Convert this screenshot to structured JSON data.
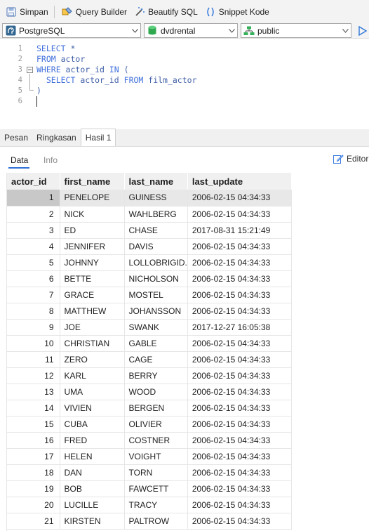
{
  "toolbar": {
    "save_label": "Simpan",
    "query_builder_label": "Query Builder",
    "beautify_label": "Beautify SQL",
    "snippet_label": "Snippet Kode"
  },
  "connection": {
    "driver": "PostgreSQL",
    "database": "dvdrental",
    "schema": "public"
  },
  "editor": {
    "line_numbers": [
      "1",
      "2",
      "3",
      "4",
      "5",
      "6"
    ],
    "lines": [
      {
        "kw1": "SELECT",
        "rest1": " *",
        "kw2": "",
        "rest2": "",
        "kw3": "",
        "rest3": ""
      },
      {
        "kw1": "FROM",
        "rest1": " actor",
        "kw2": "",
        "rest2": "",
        "kw3": "",
        "rest3": ""
      },
      {
        "kw1": "WHERE",
        "rest1": " actor_id ",
        "kw2": "IN",
        "rest2": " (",
        "kw3": "",
        "rest3": ""
      },
      {
        "kw1": "  SELECT",
        "rest1": " actor_id ",
        "kw2": "FROM",
        "rest2": " film_actor",
        "kw3": "",
        "rest3": ""
      },
      {
        "kw1": "",
        "rest1": ")",
        "kw2": "",
        "rest2": "",
        "kw3": "",
        "rest3": ""
      },
      {
        "kw1": "",
        "rest1": "",
        "kw2": "",
        "rest2": "",
        "kw3": "",
        "rest3": ""
      }
    ]
  },
  "result_tabs": [
    "Pesan",
    "Ringkasan",
    "Hasil 1"
  ],
  "sub_tabs": {
    "data": "Data",
    "info": "Info",
    "editor": "Editor"
  },
  "grid": {
    "columns": [
      "actor_id",
      "first_name",
      "last_name",
      "last_update"
    ],
    "rows": [
      [
        "1",
        "PENELOPE",
        "GUINESS",
        "2006-02-15 04:34:33"
      ],
      [
        "2",
        "NICK",
        "WAHLBERG",
        "2006-02-15 04:34:33"
      ],
      [
        "3",
        "ED",
        "CHASE",
        "2017-08-31 15:21:49"
      ],
      [
        "4",
        "JENNIFER",
        "DAVIS",
        "2006-02-15 04:34:33"
      ],
      [
        "5",
        "JOHNNY",
        "LOLLOBRIGID.",
        "2006-02-15 04:34:33"
      ],
      [
        "6",
        "BETTE",
        "NICHOLSON",
        "2006-02-15 04:34:33"
      ],
      [
        "7",
        "GRACE",
        "MOSTEL",
        "2006-02-15 04:34:33"
      ],
      [
        "8",
        "MATTHEW",
        "JOHANSSON",
        "2006-02-15 04:34:33"
      ],
      [
        "9",
        "JOE",
        "SWANK",
        "2017-12-27 16:05:38"
      ],
      [
        "10",
        "CHRISTIAN",
        "GABLE",
        "2006-02-15 04:34:33"
      ],
      [
        "11",
        "ZERO",
        "CAGE",
        "2006-02-15 04:34:33"
      ],
      [
        "12",
        "KARL",
        "BERRY",
        "2006-02-15 04:34:33"
      ],
      [
        "13",
        "UMA",
        "WOOD",
        "2006-02-15 04:34:33"
      ],
      [
        "14",
        "VIVIEN",
        "BERGEN",
        "2006-02-15 04:34:33"
      ],
      [
        "15",
        "CUBA",
        "OLIVIER",
        "2006-02-15 04:34:33"
      ],
      [
        "16",
        "FRED",
        "COSTNER",
        "2006-02-15 04:34:33"
      ],
      [
        "17",
        "HELEN",
        "VOIGHT",
        "2006-02-15 04:34:33"
      ],
      [
        "18",
        "DAN",
        "TORN",
        "2006-02-15 04:34:33"
      ],
      [
        "19",
        "BOB",
        "FAWCETT",
        "2006-02-15 04:34:33"
      ],
      [
        "20",
        "LUCILLE",
        "TRACY",
        "2006-02-15 04:34:33"
      ],
      [
        "21",
        "KIRSTEN",
        "PALTROW",
        "2006-02-15 04:34:33"
      ]
    ]
  },
  "colors": {
    "accent": "#2f6fd6",
    "keyword": "#3f6fdc",
    "db_green": "#2fa84f"
  }
}
